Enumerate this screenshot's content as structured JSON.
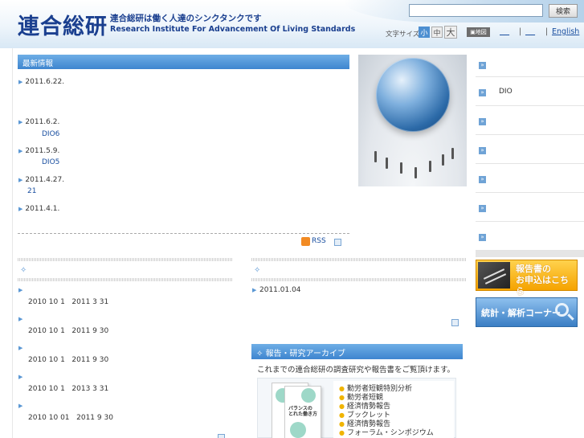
{
  "header": {
    "logo_kanji": "連合総研",
    "tagline": "連合総研は働く人達のシンクタンクです",
    "english_name": "Research Institute For Advancement Of Living Standards",
    "search_button": "検索",
    "font_size_label": "文字サイズ",
    "font_small": "小",
    "font_medium": "中",
    "font_large": "大",
    "map_button": "地図",
    "link_blank_1": "    ",
    "link_blank_2": "    ",
    "separator": "|",
    "english_link": "English"
  },
  "news": {
    "header": "最新情報",
    "items": [
      {
        "date": "2011.6.22.",
        "sub": ""
      },
      {
        "date": "2011.6.2.",
        "sub": "DIO6"
      },
      {
        "date": "2011.5.9.",
        "sub": "DIO5"
      },
      {
        "date": "2011.4.27.",
        "sub": "21"
      },
      {
        "date": "2011.4.1.",
        "sub": ""
      }
    ],
    "rss_label": "RSS"
  },
  "research": {
    "rows": [
      "2010 10 1   2011 3 31",
      "2010 10 1   2011 9 30",
      "2010 10 1   2011 9 30",
      "2010 10 1   2013 3 31",
      "2010 10 01   2011 9 30"
    ]
  },
  "events": {
    "item": "2011.01.04"
  },
  "archive": {
    "header": "報告・研究アーカイブ",
    "description": "これまでの連合総研の調査研究や報告書をご覧頂けます。",
    "book_title": "バランスの\nとれた働き方",
    "items": [
      "勤労者短観特別分析",
      "勤労者短観",
      "経済情勢報告",
      "ブックレット",
      "経済情勢報告",
      "フォーラム・シンポジウム"
    ]
  },
  "sidebar": {
    "items": [
      "",
      "DIO",
      "",
      "",
      "",
      "",
      ""
    ],
    "banner_report": "報告書の\nお申込はこちら",
    "banner_stats": "統計・解析コーナー"
  },
  "colors": {
    "brand": "#1a3f8f",
    "accent_blue": "#3e85cf",
    "banner_orange": "#f5a300"
  }
}
